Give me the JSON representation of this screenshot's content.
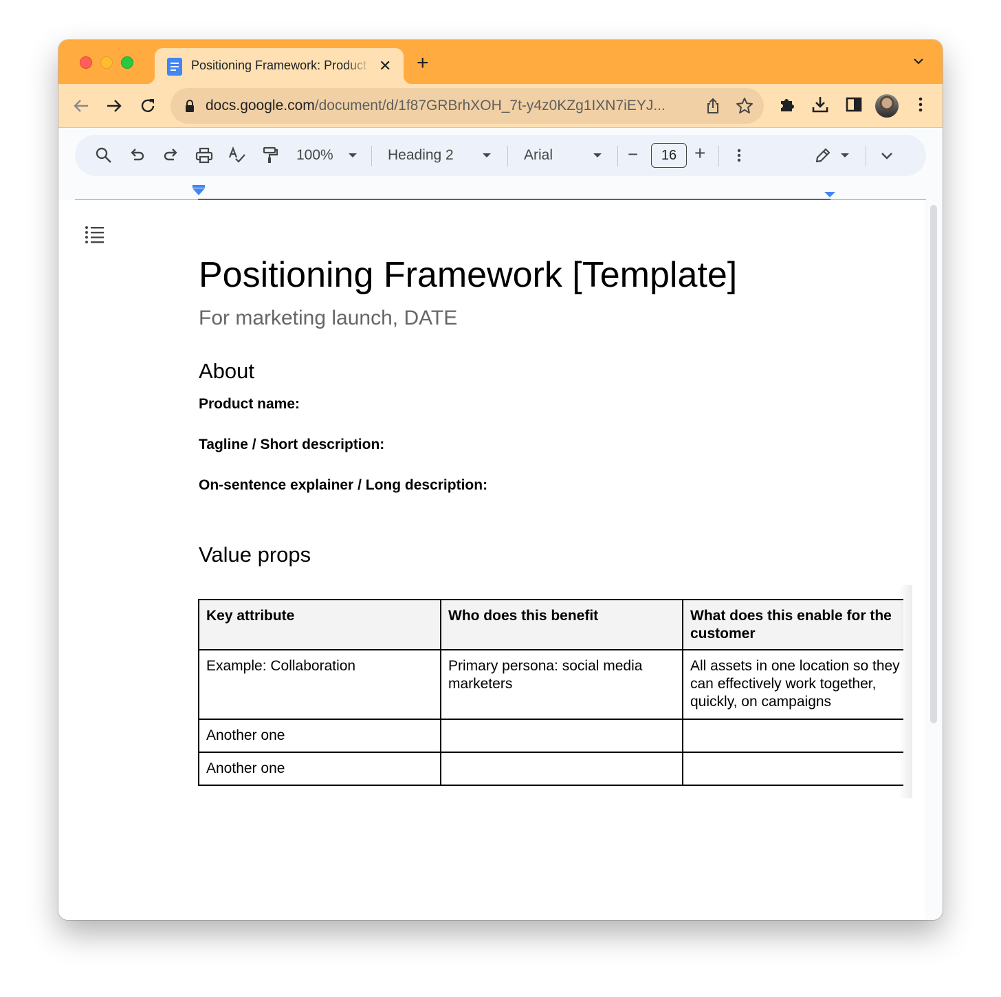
{
  "browser": {
    "tab": {
      "title": "Positioning Framework: Product Marketing Template",
      "close_glyph": "✕"
    },
    "new_tab_glyph": "+",
    "url_host": "docs.google.com",
    "url_path": "/document/d/1f87GRBrhXOH_7t-y4z0KZg1IXN7iEYJ...",
    "icons": [
      "back-arrow-icon",
      "forward-arrow-icon",
      "reload-icon",
      "lock-icon",
      "share-icon",
      "bookmark-star-icon",
      "extensions-puzzle-icon",
      "download-icon",
      "side-panel-icon",
      "profile-avatar",
      "browser-menu-icon",
      "tab-search-chevron-icon"
    ],
    "colors": {
      "tab_strip": "#ffab40",
      "toolbar": "#ffe0b2"
    }
  },
  "docs_toolbar": {
    "zoom": "100%",
    "style": "Heading 2",
    "font": "Arial",
    "font_size": "16",
    "minus_glyph": "−",
    "plus_glyph": "+"
  },
  "document": {
    "title": "Positioning Framework [Template]",
    "subtitle": "For marketing launch, DATE",
    "sections": {
      "about": "About",
      "value_props": "Value props"
    },
    "fields": {
      "product_name": "Product name:",
      "tagline": "Tagline / Short description:",
      "explainer": "On-sentence explainer / Long description:"
    },
    "table": {
      "headers": [
        "Key attribute",
        "Who does this benefit",
        "What does this enable for the customer"
      ],
      "rows": [
        [
          "Example: Collaboration",
          "Primary persona: social media marketers",
          "All assets in one location so they can effectively work together, quickly, on campaigns"
        ],
        [
          "Another one",
          "",
          ""
        ],
        [
          "Another one",
          "",
          ""
        ]
      ]
    }
  }
}
